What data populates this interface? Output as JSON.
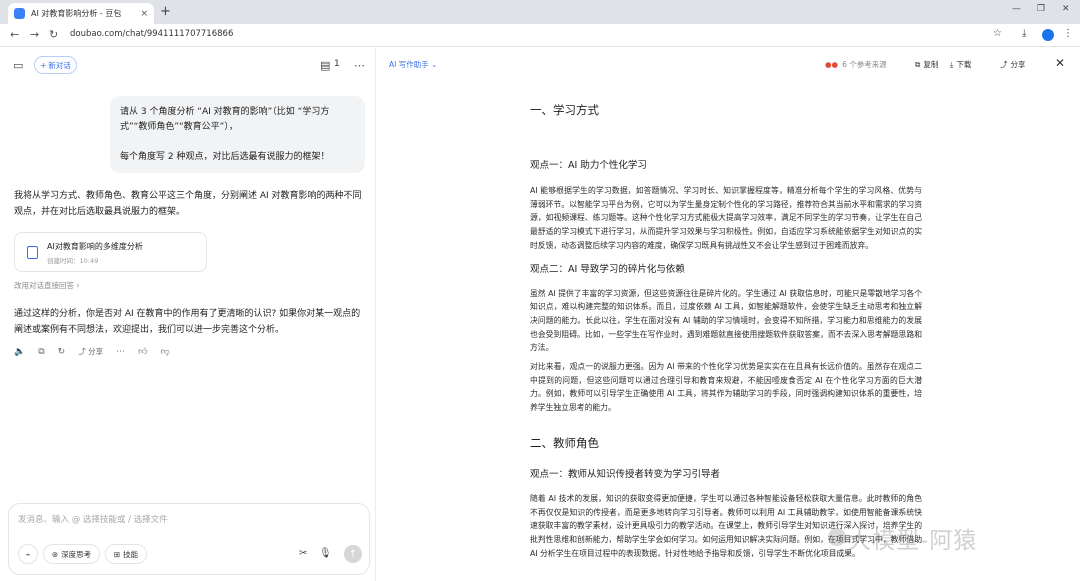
{
  "browser": {
    "tab_title": "AI 对教育影响分析 - 豆包",
    "tab_close": "×",
    "new_tab": "+",
    "url": "doubao.com/chat/9941111707716866"
  },
  "left_pane": {
    "new_chat_label": "新对话",
    "doc_count": "1",
    "user_message": [
      "请从 3 个角度分析 “AI 对教育的影响”（比如 “学习方式”“教师角色”“教育公平”），",
      "每个角度写 2 种观点，对比后选最有说服力的框架！"
    ],
    "ai_intro": "我将从学习方式、教师角色、教育公平这三个角度，分别阐述 AI 对教育影响的两种不同观点，并在对比后选取最具说服力的框架。",
    "doc_card": {
      "title": "AI对教育影响的多维度分析",
      "meta": "创建时间：10:49"
    },
    "edit_tip": "改用对话直接回答 ›",
    "ai_followup": "通过这样的分析，你是否对 AI 在教育中的作用有了更清晰的认识? 如果你对某一观点的阐述或案例有不同想法，欢迎提出，我们可以进一步完善这个分析。",
    "share_label": "分享",
    "input_placeholder": "发消息、输入 @ 选择技能或 / 选择文件",
    "deep_think_label": "深度思考",
    "skills_label": "技能"
  },
  "right_pane": {
    "writing_helper": "AI 写作助手 ⌄",
    "sources_label": "6 个参考来源",
    "copy_label": "复制",
    "download_label": "下载",
    "share_label": "分享",
    "doc": {
      "section1_title": "一、学习方式",
      "s1_view1_title": "观点一：AI 助力个性化学习",
      "s1_view1_text": "AI 能够根据学生的学习数据，如答题情况、学习时长、知识掌握程度等，精准分析每个学生的学习风格、优势与薄弱环节。以智能学习平台为例，它可以为学生量身定制个性化的学习路径，推荐符合其当前水平和需求的学习资源，如视频课程、练习题等。这种个性化学习方式能极大提高学习效率，满足不同学生的学习节奏，让学生在自己最舒适的学习模式下进行学习，从而提升学习效果与学习积极性。例如，自适应学习系统能依据学生对知识点的实时反馈，动态调整后续学习内容的难度，确保学习既具有挑战性又不会让学生感到过于困难而放弃。",
      "s1_view2_title": "观点二：AI 导致学习的碎片化与依赖",
      "s1_view2_text": "虽然 AI 提供了丰富的学习资源，但这些资源往往是碎片化的。学生通过 AI 获取信息时，可能只是零散地学习各个知识点，难以构建完整的知识体系。而且，过度依赖 AI 工具，如智能解题软件，会使学生缺乏主动思考和独立解决问题的能力。长此以往，学生在面对没有 AI 辅助的学习情境时，会变得不知所措，学习能力和思维能力的发展也会受到阻碍。比如，一些学生在写作业时，遇到难题就直接使用搜题软件获取答案，而不去深入思考解题思路和方法。",
      "s1_compare_text": "对比来看，观点一的说服力更强。因为 AI 带来的个性化学习优势是实实在在且具有长远价值的。虽然存在观点二中提到的问题，但这些问题可以通过合理引导和教育来规避，不能因噎废食否定 AI 在个性化学习方面的巨大潜力。例如，教师可以引导学生正确使用 AI 工具，将其作为辅助学习的手段，同时强调构建知识体系的重要性，培养学生独立思考的能力。",
      "section2_title": "二、教师角色",
      "s2_view1_title": "观点一：教师从知识传授者转变为学习引导者",
      "s2_view1_text": "随着 AI 技术的发展，知识的获取变得更加便捷，学生可以通过各种智能设备轻松获取大量信息。此时教师的角色不再仅仅是知识的传授者，而是更多地转向学习引导者。教师可以利用 AI 工具辅助教学，如使用智能备课系统快速获取丰富的教学素材，设计更具吸引力的教学活动。在课堂上，教师引导学生对知识进行深入探讨，培养学生的批判性思维和创新能力，帮助学生学会如何学习。如何运用知识解决实际问题。例如，在项目式学习中，教师借助 AI 分析学生在项目过程中的表现数据，针对性地给予指导和反馈，引导学生不断优化项目成果。"
    }
  },
  "watermark": "大模型-阿猿"
}
